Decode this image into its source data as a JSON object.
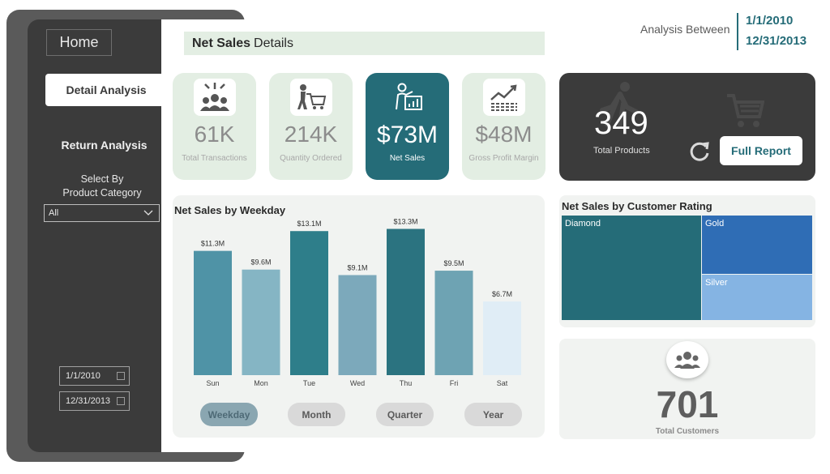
{
  "sidebar": {
    "home_label": "Home",
    "detail_label": "Detail Analysis",
    "return_label": "Return Analysis",
    "select_label_line1": "Select By",
    "select_label_line2": "Product Category",
    "select_value": "All",
    "start_date": "1/1/2010",
    "end_date": "12/31/2013"
  },
  "header": {
    "title_bold": "Net Sales",
    "title_rest": "Details",
    "range_label": "Analysis Between",
    "range_start": "1/1/2010",
    "range_end": "12/31/2013"
  },
  "kpis": [
    {
      "value": "61K",
      "label": "Total Transactions",
      "icon": "people-group-icon"
    },
    {
      "value": "214K",
      "label": "Quantity Ordered",
      "icon": "shopping-cart-person-icon"
    },
    {
      "value": "$73M",
      "label": "Net Sales",
      "icon": "presenter-chart-icon"
    },
    {
      "value": "$48M",
      "label": "Gross Profit Margin",
      "icon": "line-chart-icon"
    }
  ],
  "products": {
    "value": "349",
    "label": "Total Products",
    "button_label": "Full Report"
  },
  "weekday_chart": {
    "title": "Net Sales by Weekday",
    "toggles": [
      "Weekday",
      "Month",
      "Quarter",
      "Year"
    ],
    "active_toggle": "Weekday"
  },
  "chart_data": {
    "type": "bar",
    "title": "Net Sales by Weekday",
    "categories": [
      "Sun",
      "Mon",
      "Tue",
      "Wed",
      "Thu",
      "Fri",
      "Sat"
    ],
    "values": [
      11.3,
      9.6,
      13.1,
      9.1,
      13.3,
      9.5,
      6.7
    ],
    "data_labels": [
      "$11.3M",
      "$9.6M",
      "$13.1M",
      "$9.1M",
      "$13.3M",
      "$9.5M",
      "$6.7M"
    ],
    "colors": [
      "#4f93a6",
      "#85b5c4",
      "#2e7e8a",
      "#7ca9bb",
      "#2b7380",
      "#6ea3b3",
      "#e0edf6"
    ],
    "ylim": [
      0,
      14
    ],
    "grid": false
  },
  "rating_chart": {
    "title": "Net Sales by Customer Rating",
    "tiles": [
      {
        "label": "Diamond",
        "color": "#256c78"
      },
      {
        "label": "Gold",
        "color": "#2f6db5"
      },
      {
        "label": "Silver",
        "color": "#85b4e3"
      }
    ]
  },
  "customers": {
    "value": "701",
    "label": "Total Customers"
  },
  "colors": {
    "accent": "#256c78",
    "sidebar_dark": "#3b3b3b",
    "kpi_bg": "#e3eee3"
  }
}
